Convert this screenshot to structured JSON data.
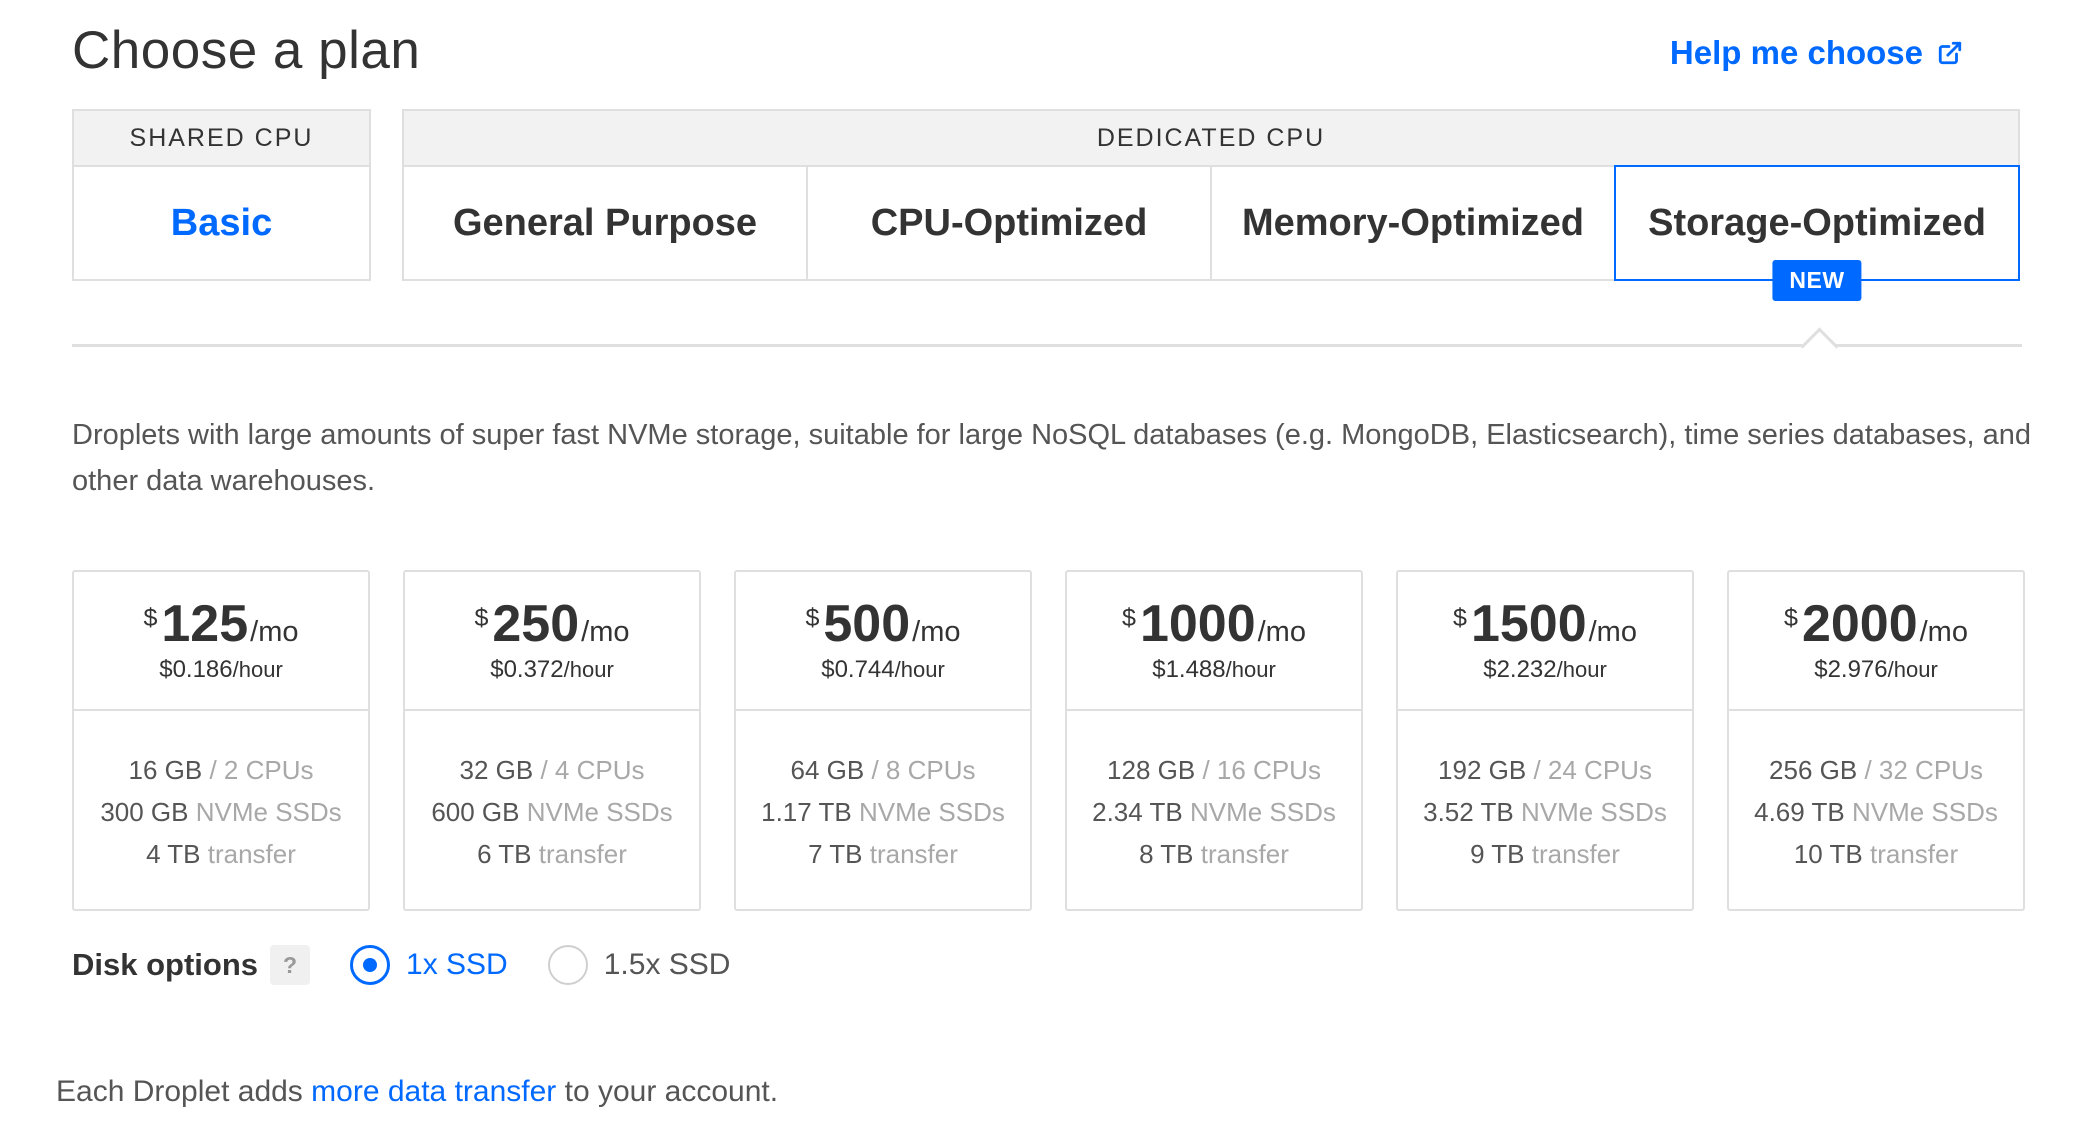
{
  "page": {
    "title": "Choose a plan",
    "help_link": "Help me choose"
  },
  "categories": {
    "shared_header": "SHARED CPU",
    "dedicated_header": "DEDICATED CPU",
    "tabs": [
      {
        "label": "Basic"
      },
      {
        "label": "General Purpose"
      },
      {
        "label": "CPU-Optimized"
      },
      {
        "label": "Memory-Optimized"
      },
      {
        "label": "Storage-Optimized",
        "badge": "NEW",
        "selected": true
      }
    ]
  },
  "description": "Droplets with large amounts of super fast NVMe storage, suitable for large NoSQL databases (e.g. MongoDB, Elasticsearch), time series databases, and other data warehouses.",
  "plans": [
    {
      "currency": "$",
      "monthly": "125",
      "per_month": "/mo",
      "hourly": "$0.186",
      "per_hour": "/hour",
      "ram": "16 GB",
      "cpus": "/ 2 CPUs",
      "storage": "300 GB",
      "storage_unit": "NVMe SSDs",
      "transfer": "4 TB",
      "transfer_unit": "transfer"
    },
    {
      "currency": "$",
      "monthly": "250",
      "per_month": "/mo",
      "hourly": "$0.372",
      "per_hour": "/hour",
      "ram": "32 GB",
      "cpus": "/ 4 CPUs",
      "storage": "600 GB",
      "storage_unit": "NVMe SSDs",
      "transfer": "6 TB",
      "transfer_unit": "transfer"
    },
    {
      "currency": "$",
      "monthly": "500",
      "per_month": "/mo",
      "hourly": "$0.744",
      "per_hour": "/hour",
      "ram": "64 GB",
      "cpus": "/ 8 CPUs",
      "storage": "1.17 TB",
      "storage_unit": "NVMe SSDs",
      "transfer": "7 TB",
      "transfer_unit": "transfer"
    },
    {
      "currency": "$",
      "monthly": "1000",
      "per_month": "/mo",
      "hourly": "$1.488",
      "per_hour": "/hour",
      "ram": "128 GB",
      "cpus": "/ 16 CPUs",
      "storage": "2.34 TB",
      "storage_unit": "NVMe SSDs",
      "transfer": "8 TB",
      "transfer_unit": "transfer"
    },
    {
      "currency": "$",
      "monthly": "1500",
      "per_month": "/mo",
      "hourly": "$2.232",
      "per_hour": "/hour",
      "ram": "192 GB",
      "cpus": "/ 24 CPUs",
      "storage": "3.52 TB",
      "storage_unit": "NVMe SSDs",
      "transfer": "9 TB",
      "transfer_unit": "transfer"
    },
    {
      "currency": "$",
      "monthly": "2000",
      "per_month": "/mo",
      "hourly": "$2.976",
      "per_hour": "/hour",
      "ram": "256 GB",
      "cpus": "/ 32 CPUs",
      "storage": "4.69 TB",
      "storage_unit": "NVMe SSDs",
      "transfer": "10 TB",
      "transfer_unit": "transfer"
    }
  ],
  "disk_options": {
    "label": "Disk options",
    "help": "?",
    "options": [
      {
        "label": "1x SSD",
        "selected": true
      },
      {
        "label": "1.5x SSD",
        "selected": false
      }
    ]
  },
  "footer": {
    "prefix": "Each Droplet adds ",
    "link": "more data transfer",
    "suffix": " to your account."
  },
  "colors": {
    "accent": "#0069ff",
    "border": "#dfdfdf",
    "muted_text": "#a8a8a8"
  },
  "icons": {
    "help_link_icon": "external-link-icon",
    "radio_selected": "radio-selected-icon",
    "radio_unselected": "radio-unselected-icon"
  }
}
